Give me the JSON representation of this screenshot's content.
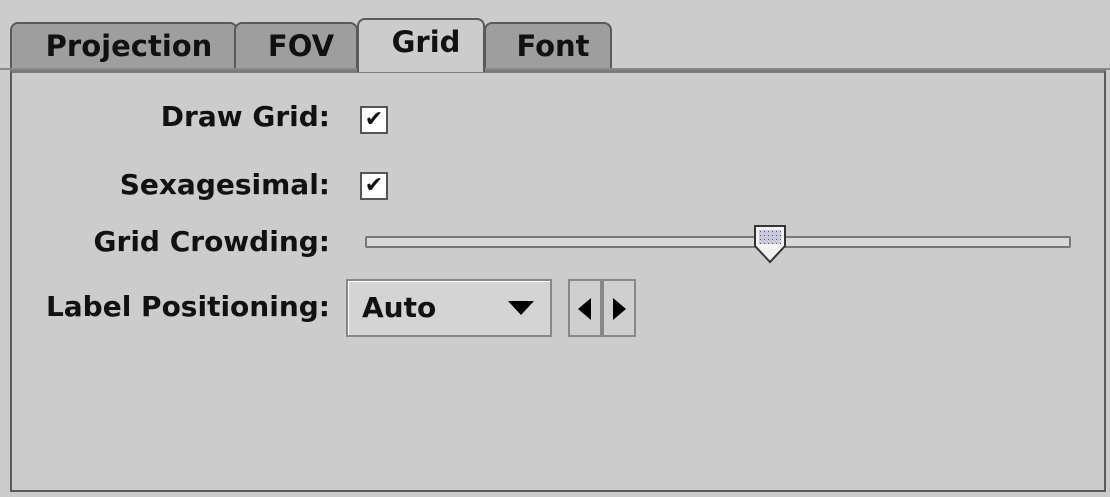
{
  "tabs": [
    {
      "label": "Projection",
      "active": false
    },
    {
      "label": "FOV",
      "active": false
    },
    {
      "label": "Grid",
      "active": true
    },
    {
      "label": "Font",
      "active": false
    }
  ],
  "grid_panel": {
    "draw_grid": {
      "label": "Draw Grid:",
      "checked": true,
      "mark": "✔"
    },
    "sexagesimal": {
      "label": "Sexagesimal:",
      "checked": true,
      "mark": "✔"
    },
    "grid_crowding": {
      "label": "Grid Crowding:",
      "value_fraction": 0.57
    },
    "label_positioning": {
      "label": "Label Positioning:",
      "selected": "Auto"
    }
  },
  "icons": {
    "combo_arrow": "chevron-down-icon",
    "spin_left": "arrow-left-icon",
    "spin_right": "arrow-right-icon"
  },
  "colors": {
    "background": "#cccccc",
    "tab_inactive": "#9e9e9e"
  }
}
